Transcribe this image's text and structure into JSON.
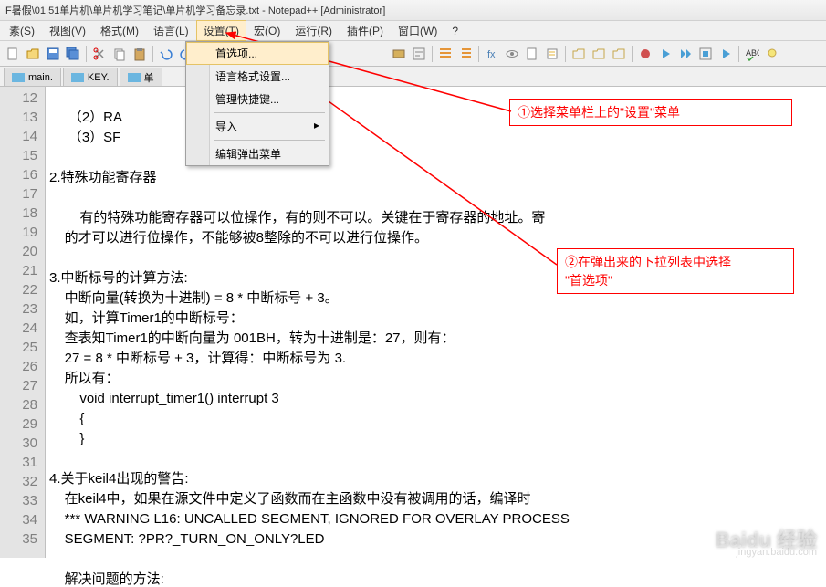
{
  "window": {
    "title": "F暑假\\01.51单片机\\单片机学习笔记\\单片机学习备忘录.txt - Notepad++ [Administrator]"
  },
  "menubar": {
    "items": [
      "素(S)",
      "视图(V)",
      "格式(M)",
      "语言(L)",
      "设置(T)",
      "宏(O)",
      "运行(R)",
      "插件(P)",
      "窗口(W)",
      "?"
    ]
  },
  "dropdown": {
    "items": [
      "首选项...",
      "语言格式设置...",
      "管理快捷键...",
      "导入",
      "编辑弹出菜单"
    ]
  },
  "tabs": {
    "items": [
      "main.",
      "KEY.",
      "单"
    ]
  },
  "gutter": {
    "lines": [
      "12",
      "13",
      "14",
      "15",
      "16",
      "17",
      "18",
      "19",
      "20",
      "21",
      "22",
      "23",
      "24",
      "25",
      "26",
      "27",
      "28",
      "29",
      "30",
      "31",
      "32",
      "33",
      "34",
      "35"
    ]
  },
  "code": {
    "l12": "     （2）RA",
    "l13": "     （3）SF                           器 ）",
    "l14": "",
    "l15": "2.特殊功能寄存器",
    "l16": "",
    "l17": "        有的特殊功能寄存器可以位操作，有的则不可以。关键在于寄存器的地址。寄",
    "l18": "    的才可以进行位操作，不能够被8整除的不可以进行位操作。",
    "l19": "",
    "l20": "3.中断标号的计算方法:",
    "l21": "    中断向量(转换为十进制) = 8 * 中断标号 + 3。",
    "l22": "    如，计算Timer1的中断标号：",
    "l23": "    查表知Timer1的中断向量为 001BH，转为十进制是：27，则有：",
    "l24": "    27 = 8 * 中断标号 + 3，计算得：中断标号为 3.",
    "l25": "    所以有：",
    "l26": "        void interrupt_timer1() interrupt 3",
    "l27": "        {",
    "l28": "        }",
    "l29": "",
    "l30": "4.关于keil4出现的警告:",
    "l31": "    在keil4中，如果在源文件中定义了函数而在主函数中没有被调用的话，编译时",
    "l32": "    *** WARNING L16: UNCALLED SEGMENT, IGNORED FOR OVERLAY PROCESS",
    "l33": "    SEGMENT: ?PR?_TURN_ON_ONLY?LED",
    "l34": "",
    "l35": "    解决问题的方法:"
  },
  "annotations": {
    "a1": "①选择菜单栏上的\"设置\"菜单",
    "a2_l1": "②在弹出来的下拉列表中选择",
    "a2_l2": "\"首选项\""
  },
  "watermark": {
    "main": "Baidu 经验",
    "sub": "jingyan.baidu.com"
  }
}
